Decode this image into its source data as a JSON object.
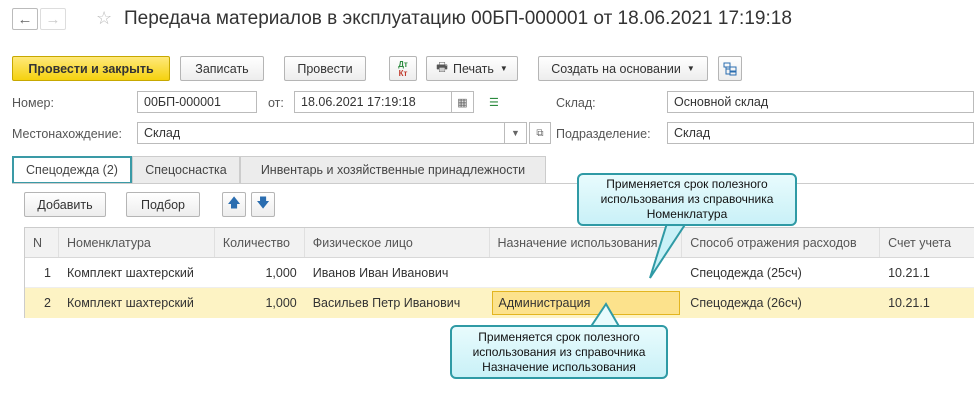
{
  "header": {
    "title": "Передача материалов в эксплуатацию 00БП-000001 от 18.06.2021 17:19:18",
    "back_icon": "arrow-left",
    "forward_icon": "arrow-right",
    "star_icon": "star"
  },
  "toolbar": {
    "post_close": "Провести и закрыть",
    "save": "Записать",
    "post": "Провести",
    "dtkt_top": "Дт",
    "dtkt_bottom": "Кт",
    "print": "Печать",
    "create_based": "Создать на основании"
  },
  "form": {
    "number_label": "Номер:",
    "number_value": "00БП-000001",
    "date_label": "от:",
    "date_value": "18.06.2021 17:19:18",
    "warehouse_label": "Склад:",
    "warehouse_value": "Основной склад",
    "location_label": "Местонахождение:",
    "location_value": "Склад",
    "department_label": "Подразделение:",
    "department_value": "Склад"
  },
  "tabs": [
    {
      "label": "Спецодежда (2)"
    },
    {
      "label": "Спецоснастка"
    },
    {
      "label": "Инвентарь и хозяйственные принадлежности"
    }
  ],
  "table_toolbar": {
    "add": "Добавить",
    "select": "Подбор"
  },
  "table": {
    "columns": [
      "N",
      "Номенклатура",
      "Количество",
      "Физическое лицо",
      "Назначение использования",
      "Способ отражения расходов",
      "Счет учета"
    ],
    "rows": [
      [
        "1",
        "Комплект шахтерский",
        "1,000",
        "Иванов Иван Иванович",
        "",
        "Спецодежда (25сч)",
        "10.21.1"
      ],
      [
        "2",
        "Комплект шахтерский",
        "1,000",
        "Васильев Петр Иванович",
        "Администрация",
        "Спецодежда (26сч)",
        "10.21.1"
      ]
    ]
  },
  "callouts": {
    "top": [
      "Применяется срок полезного",
      "использования из справочника",
      "Номенклатура"
    ],
    "bottom": [
      "Применяется срок полезного",
      "использования из справочника",
      "Назначение использования"
    ]
  },
  "colors": {
    "accent": "#3a9aa6",
    "primary_button": "#f5d20f",
    "selected_row": "#fdf3c4",
    "selected_cell": "#fce28c"
  }
}
